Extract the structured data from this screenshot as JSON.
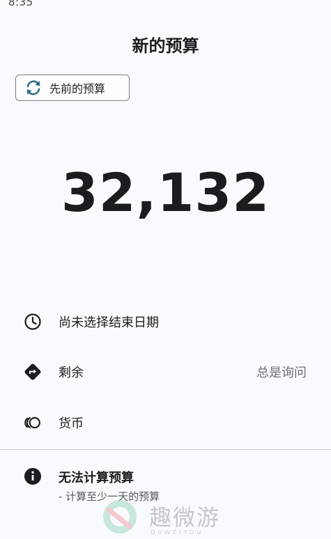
{
  "status_bar": {
    "time": "8:35"
  },
  "header": {
    "title": "新的预算"
  },
  "previous_budget": {
    "label": "先前的预算"
  },
  "budget": {
    "amount": "32,132"
  },
  "settings": {
    "end_date": {
      "label": "尚未选择结束日期",
      "icon": "clock-icon"
    },
    "remaining": {
      "label": "剩余",
      "value": "总是询问",
      "icon": "direction-icon"
    },
    "currency": {
      "label": "货币",
      "icon": "currency-icon"
    }
  },
  "info": {
    "icon": "info-icon",
    "title": "无法计算预算",
    "subtitle": "- 计算至少一天的预算"
  },
  "watermark": {
    "brand": "趣微游",
    "sub": "QUWEIYOU"
  },
  "colors": {
    "accent": "#2a6f86",
    "text": "#1c1d21",
    "muted": "#6e7077",
    "background": "#f9fafd"
  }
}
